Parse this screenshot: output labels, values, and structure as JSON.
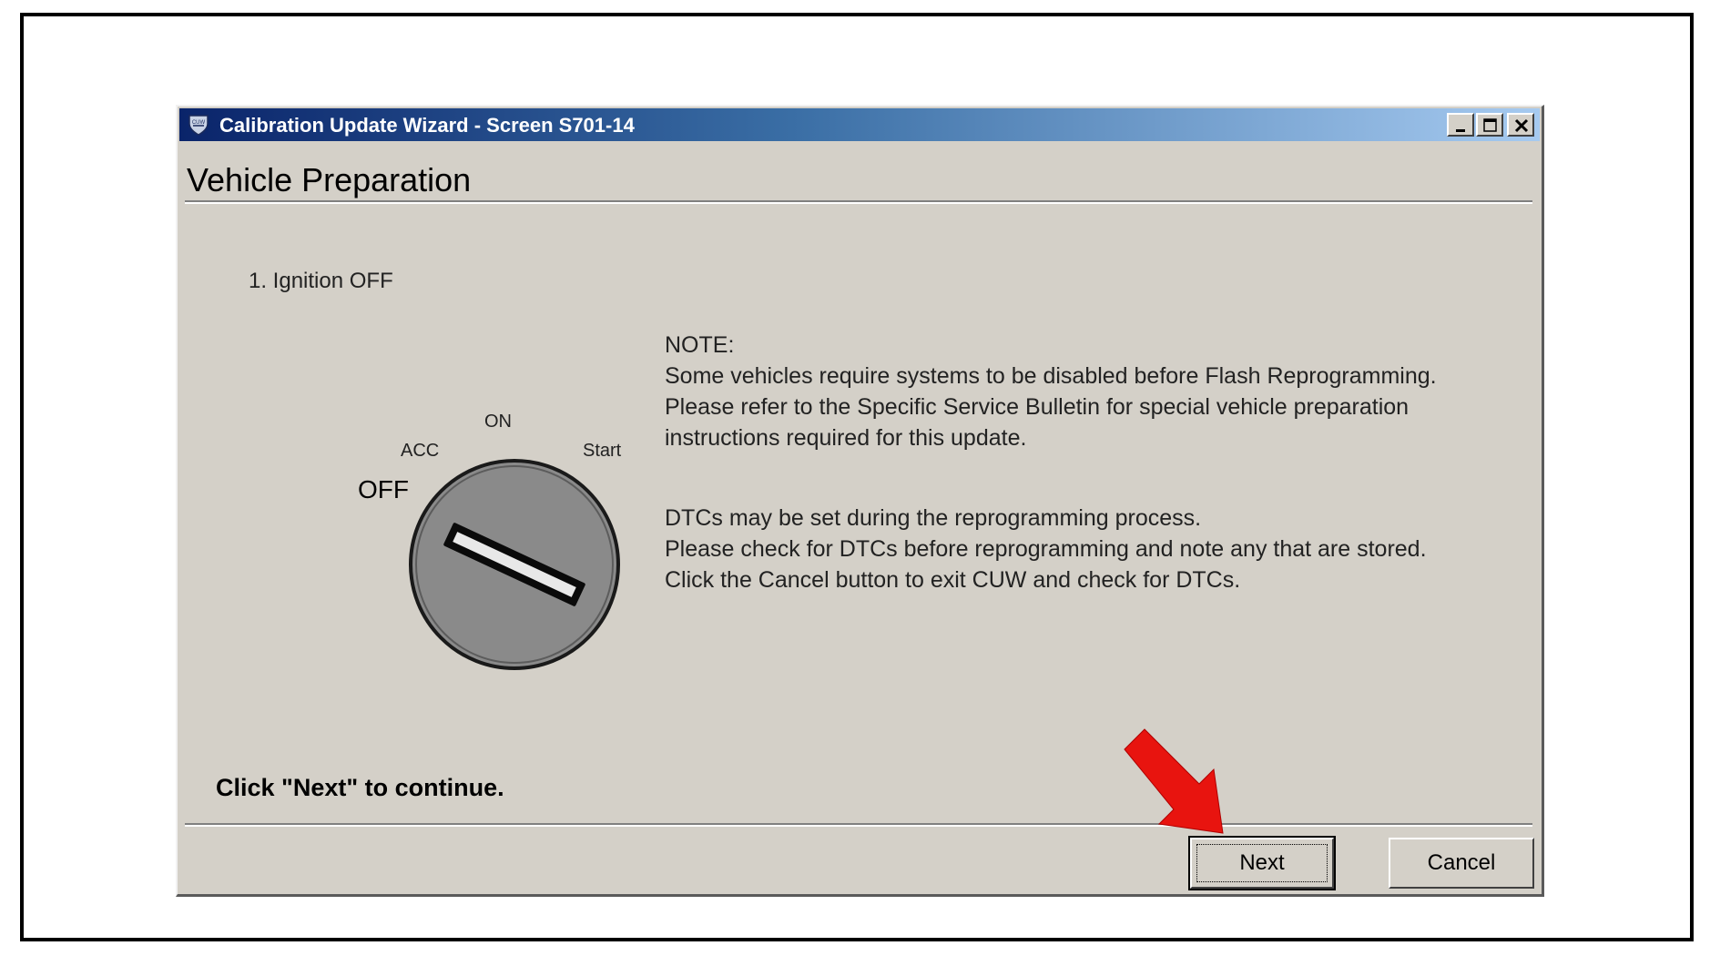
{
  "window": {
    "title": "Calibration Update Wizard - Screen S701-14",
    "icon": "cuw-shield-icon",
    "controls": [
      "minimize",
      "maximize",
      "close"
    ]
  },
  "header": {
    "title": "Vehicle Preparation"
  },
  "step": {
    "label": "1. Ignition OFF"
  },
  "ignition_diagram": {
    "positions": {
      "off": "OFF",
      "acc": "ACC",
      "on": "ON",
      "start": "Start"
    },
    "current_position": "OFF"
  },
  "note": {
    "heading": "NOTE:",
    "line1": "Some vehicles require systems to be disabled before Flash Reprogramming.",
    "line2": "Please refer to the Specific Service Bulletin for special vehicle preparation",
    "line3": "instructions required for this update."
  },
  "dtc": {
    "line1": "DTCs may be set during the reprogramming process.",
    "line2": "Please check for DTCs before reprogramming and note any that are stored.",
    "line3": "Click the Cancel button to exit CUW and check for DTCs."
  },
  "instruction": "Click \"Next\" to continue.",
  "buttons": {
    "next": "Next",
    "cancel": "Cancel"
  },
  "colors": {
    "arrow": "#e8140f",
    "dialog_bg": "#d4d0c8",
    "titlebar_start": "#0a246a",
    "titlebar_end": "#a6caf0"
  }
}
